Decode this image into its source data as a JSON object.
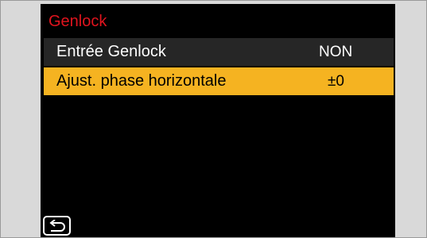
{
  "menu": {
    "title": "Genlock",
    "items": [
      {
        "label": "Entrée Genlock",
        "value": "NON"
      },
      {
        "label": "Ajust. phase horizontale",
        "value": "±0"
      }
    ]
  },
  "icons": {
    "back": "return-arrow-icon"
  },
  "colors": {
    "title": "#e0141e",
    "highlight": "#f5b321",
    "row_bg": "#262626",
    "screen_bg": "#000000",
    "side_bg": "#d9d9d9"
  }
}
